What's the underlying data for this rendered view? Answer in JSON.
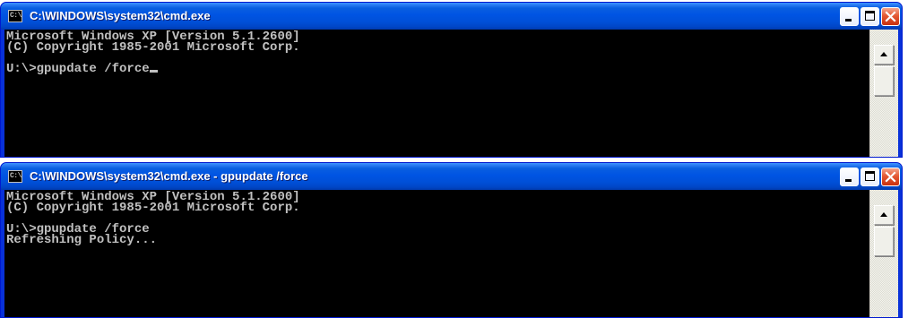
{
  "windows": [
    {
      "title": "C:\\WINDOWS\\system32\\cmd.exe",
      "icon": "cmd-icon",
      "icon_text": "C:\\",
      "controls": {
        "minimize": "minimize-icon",
        "maximize": "maximize-icon",
        "close": "close-icon"
      },
      "lines": [
        "Microsoft Windows XP [Version 5.1.2600]",
        "(C) Copyright 1985-2001 Microsoft Corp.",
        "",
        "U:\\>gpupdate /force"
      ],
      "cursor_visible": true
    },
    {
      "title": "C:\\WINDOWS\\system32\\cmd.exe - gpupdate /force",
      "icon": "cmd-icon",
      "icon_text": "C:\\",
      "controls": {
        "minimize": "minimize-icon",
        "maximize": "maximize-icon",
        "close": "close-icon"
      },
      "lines": [
        "Microsoft Windows XP [Version 5.1.2600]",
        "(C) Copyright 1985-2001 Microsoft Corp.",
        "",
        "U:\\>gpupdate /force",
        "Refreshing Policy..."
      ],
      "cursor_visible": false
    }
  ],
  "colors": {
    "titlebar": "#0054e3",
    "console_bg": "#000000",
    "console_text": "#c0c0c0",
    "close_button": "#e04a2a"
  }
}
